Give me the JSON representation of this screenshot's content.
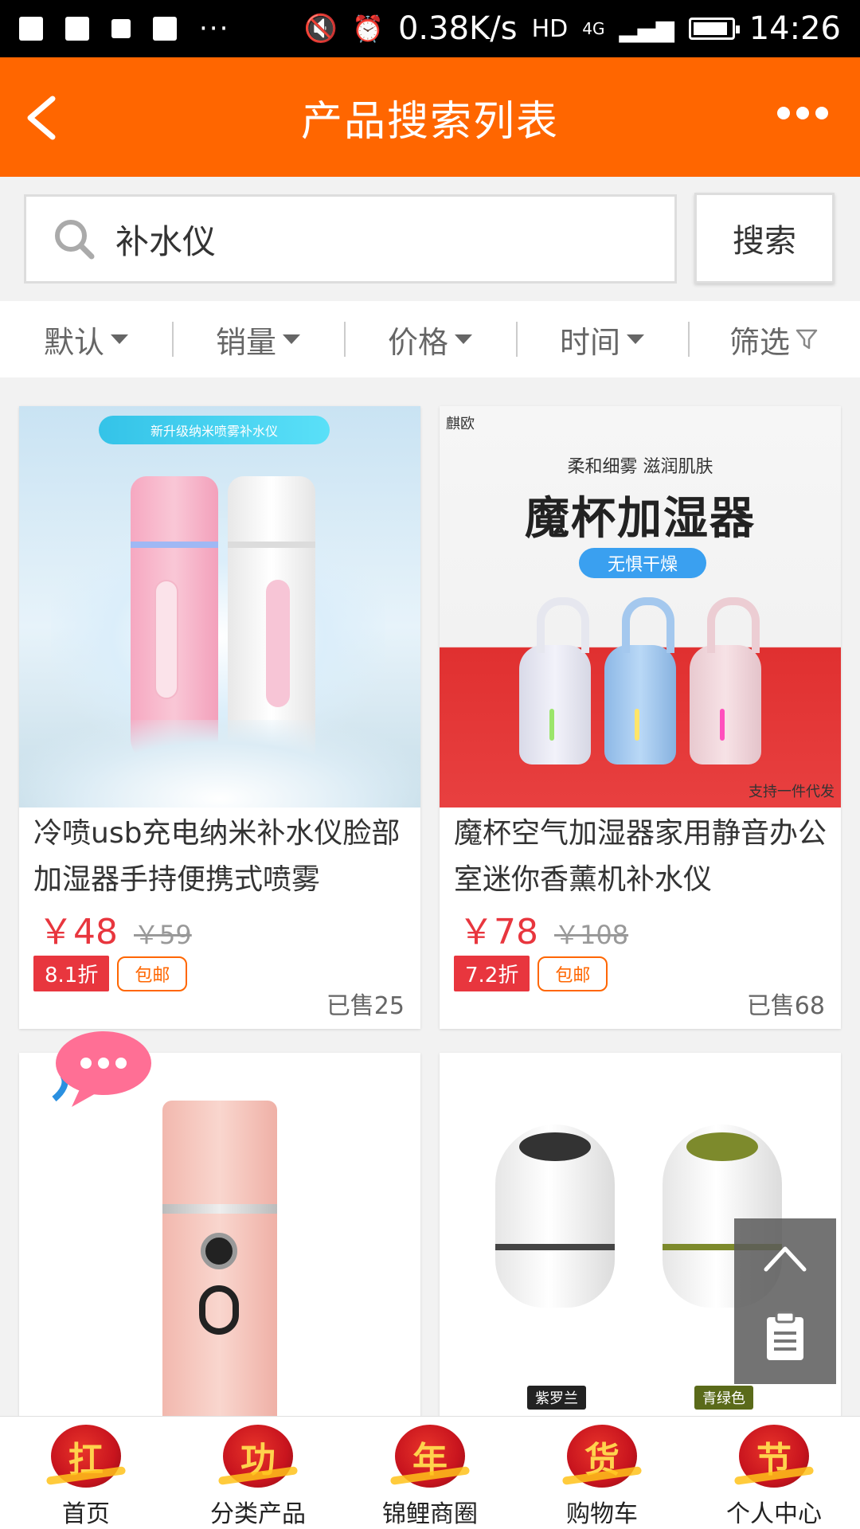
{
  "status_bar": {
    "network_speed": "0.38K/s",
    "hd": "HD",
    "net_type": "4G",
    "time": "14:26",
    "more_dots": "···"
  },
  "header": {
    "title": "产品搜索列表"
  },
  "search": {
    "value": "补水仪",
    "button_label": "搜索"
  },
  "sort_tabs": [
    {
      "label": "默认",
      "icon": "caret-down-icon"
    },
    {
      "label": "销量",
      "icon": "caret-down-icon"
    },
    {
      "label": "价格",
      "icon": "caret-down-icon"
    },
    {
      "label": "时间",
      "icon": "caret-down-icon"
    },
    {
      "label": "筛选",
      "icon": "funnel-icon"
    }
  ],
  "products": [
    {
      "title": "冷喷usb充电纳米补水仪脸部加湿器手持便携式喷雾",
      "price": "￥48",
      "original_price": "￥59",
      "discount": "8.1折",
      "shipping": "包邮",
      "sold": "已售25",
      "image_text": {
        "banner": "新升级纳米喷雾补水仪"
      }
    },
    {
      "title": "魔杯空气加湿器家用静音办公室迷你香薰机补水仪",
      "price": "￥78",
      "original_price": "￥108",
      "discount": "7.2折",
      "shipping": "包邮",
      "sold": "已售68",
      "image_text": {
        "logo": "麒欧",
        "subtitle": "柔和细雾 滋润肌肤",
        "headline": "魔杯加湿器",
        "badge": "无惧干燥",
        "watermark": "支持一件代发"
      }
    },
    {
      "title": "",
      "image_text": {}
    },
    {
      "title": "",
      "image_text": {
        "label_left": "紫罗兰",
        "label_right": "青绿色"
      }
    }
  ],
  "bottom_nav": [
    {
      "label": "首页",
      "glyph": "扛"
    },
    {
      "label": "分类产品",
      "glyph": "功"
    },
    {
      "label": "锦鲤商圈",
      "glyph": "年"
    },
    {
      "label": "购物车",
      "glyph": "货"
    },
    {
      "label": "个人中心",
      "glyph": "节"
    }
  ],
  "colors": {
    "accent": "#ff6600",
    "price": "#e8363e",
    "nav_red": "#c8141e"
  }
}
